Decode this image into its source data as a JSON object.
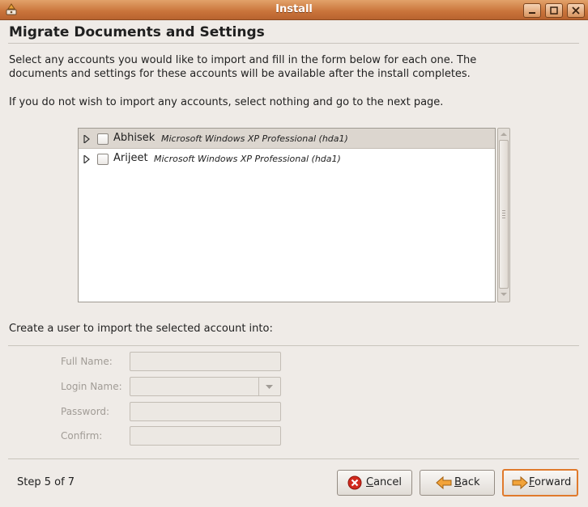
{
  "window": {
    "title": "Install"
  },
  "page": {
    "title": "Migrate Documents and Settings",
    "intro_line1": "Select any accounts you would like to import and fill in the form below for each one.  The",
    "intro_line2": "documents and settings for these accounts will be available after the install completes.",
    "intro_line3": "If you do not wish to import any accounts, select nothing and go to the next page."
  },
  "accounts": [
    {
      "name": "Abhisek",
      "os": "Microsoft Windows XP Professional (hda1)",
      "checked": false,
      "selected": true
    },
    {
      "name": "Arijeet",
      "os": "Microsoft Windows XP Professional (hda1)",
      "checked": false,
      "selected": false
    }
  ],
  "form": {
    "heading": "Create a user to import the selected account into:",
    "full_name_label": "Full Name:",
    "login_name_label": "Login Name:",
    "password_label": "Password:",
    "confirm_label": "Confirm:",
    "full_name_value": "",
    "login_name_value": "",
    "password_value": "",
    "confirm_value": ""
  },
  "footer": {
    "step": "Step 5 of 7",
    "cancel_first": "C",
    "cancel_rest": "ancel",
    "back_first": "B",
    "back_rest": "ack",
    "forward_first": "F",
    "forward_rest": "orward"
  },
  "icons": {
    "app": "installer-icon",
    "minimize": "minimize-icon",
    "maximize": "maximize-icon",
    "close": "close-icon",
    "cancel": "cancel-icon",
    "back": "back-arrow-icon",
    "forward": "forward-arrow-icon"
  },
  "colors": {
    "titlebar": "#c9733a",
    "default_button_border": "#e07a2c",
    "selected_row": "#dcd6cf"
  }
}
